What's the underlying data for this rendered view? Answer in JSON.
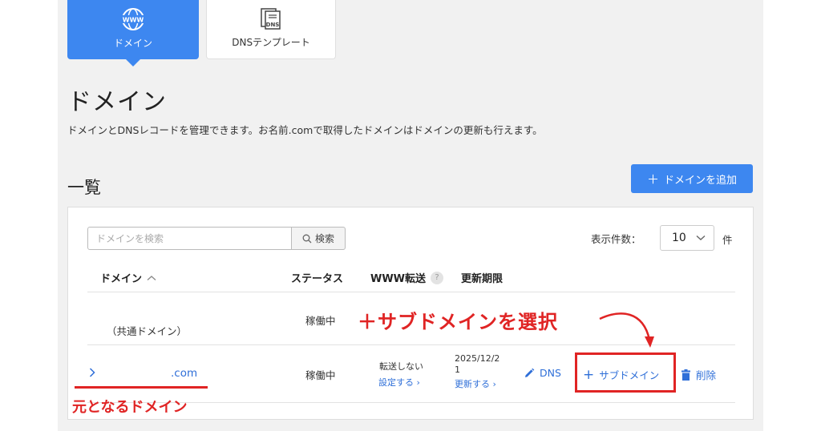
{
  "tabs": [
    {
      "label": "ドメイン",
      "active": true,
      "icon": "globe-www-icon"
    },
    {
      "label": "DNSテンプレート",
      "active": false,
      "icon": "dns-document-icon"
    }
  ],
  "tab_icon_text": {
    "www": "WWW",
    "dns": "DNS"
  },
  "page": {
    "title": "ドメイン",
    "description": "ドメインとDNSレコードを管理できます。お名前.comで取得したドメインはドメインの更新も行えます。"
  },
  "list": {
    "section_title": "一覧",
    "add_button": "ドメインを追加",
    "search_placeholder": "ドメインを検索",
    "search_button": "検索",
    "per_page_label": "表示件数：",
    "per_page_value": "10",
    "per_page_unit": "件"
  },
  "table": {
    "headers": {
      "domain": "ドメイン",
      "status": "ステータス",
      "www": "WWW転送",
      "www_help": "?",
      "expiry": "更新期限"
    },
    "rows": [
      {
        "domain": "（共通ドメイン）",
        "status": "稼働中"
      },
      {
        "domain": ".com",
        "status": "稼働中",
        "www_state": "転送しない",
        "www_link": "設定する ›",
        "expiry_date": "2025/12/2",
        "expiry_date_2": "1",
        "expiry_link": "更新する ›",
        "dns_label": "DNS",
        "subdomain_label": "サブドメイン",
        "delete_label": "削除"
      }
    ]
  },
  "annotations": {
    "select_subdomain": "＋サブドメインを選択",
    "original_domain": "元となるドメイン"
  },
  "colors": {
    "accent": "#3d87f0",
    "link": "#2f6fd8",
    "annotation": "#e02424"
  }
}
